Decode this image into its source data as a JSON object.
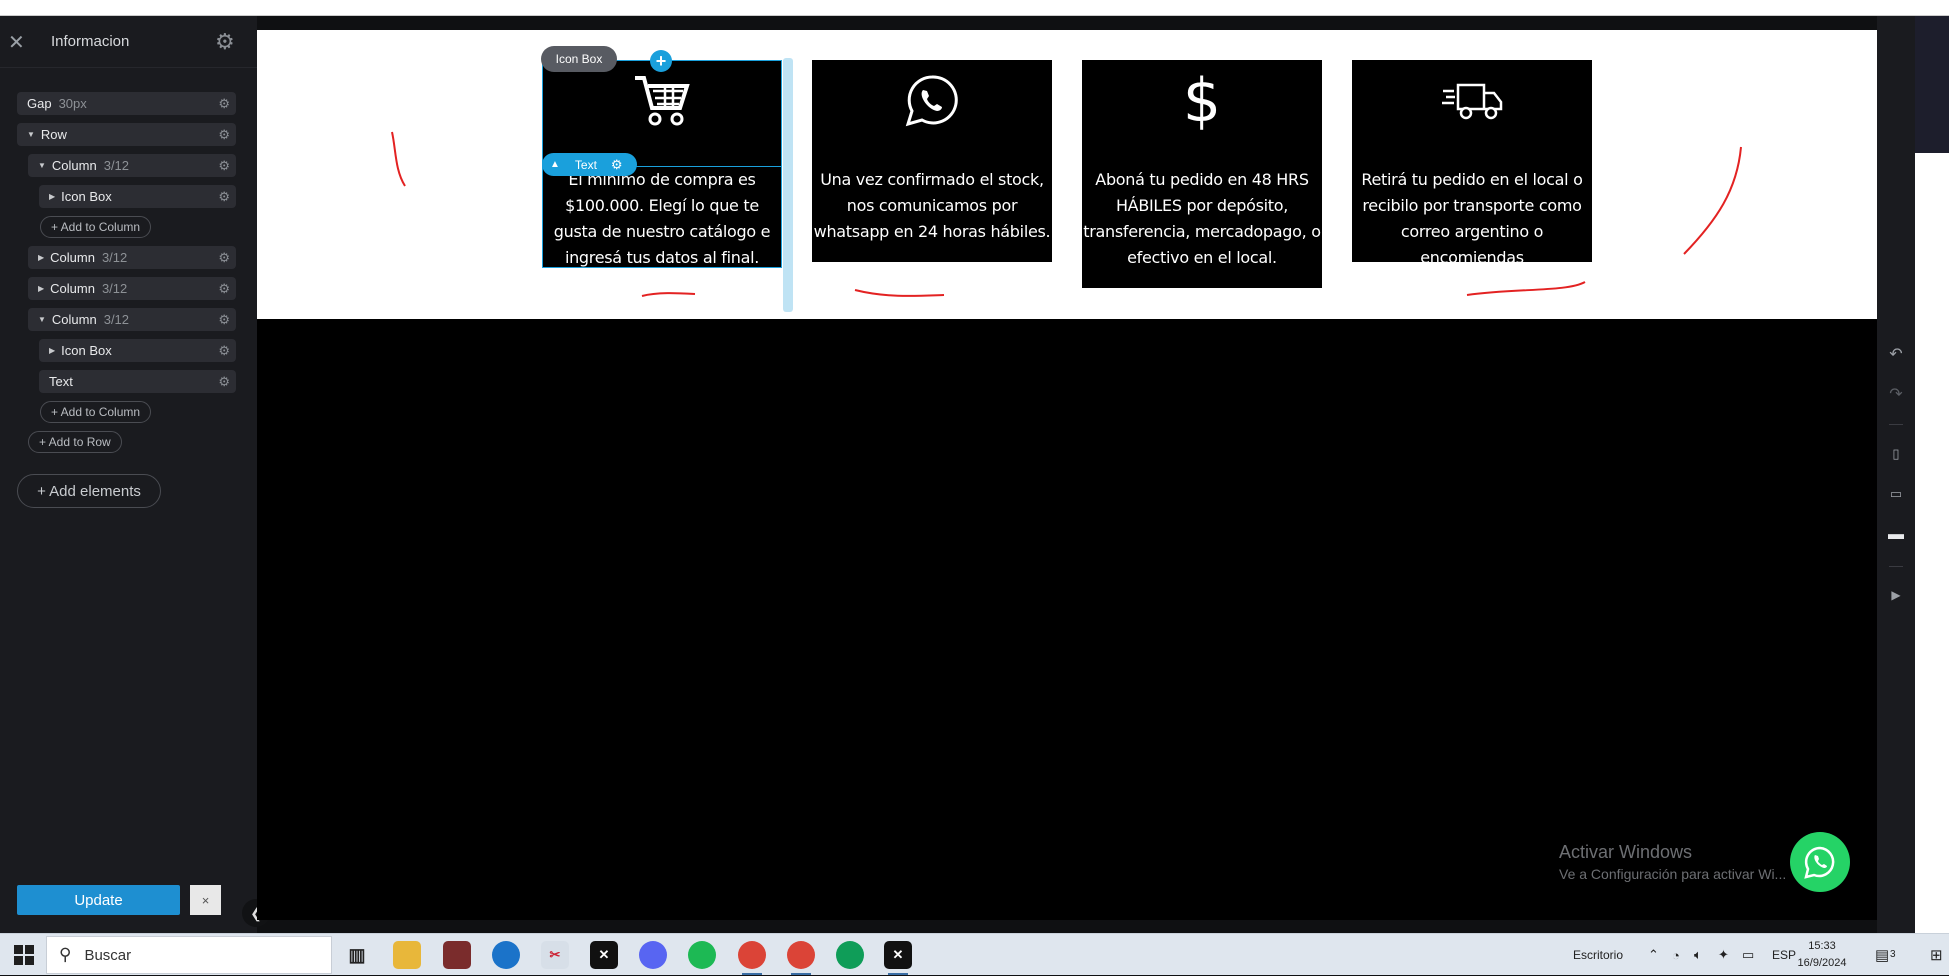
{
  "sidebar": {
    "title": "Informacion",
    "tree": {
      "gap_label": "Gap",
      "gap_value": "30px",
      "row_label": "Row",
      "column_label": "Column",
      "column_size": "3/12",
      "icon_box_label": "Icon Box",
      "text_label": "Text",
      "add_to_column": "+ Add to Column",
      "add_to_row": "+ Add to Row"
    },
    "add_elements": "+ Add elements",
    "update_label": "Update",
    "close_label": "×"
  },
  "canvas": {
    "icon_box_tag": "Icon Box",
    "text_tag": "Text",
    "cards": [
      {
        "icon": "shopping-cart-icon",
        "text": "El mínimo de compra es $100.000. Elegí lo que te gusta de nuestro catálogo e ingresá tus datos al final."
      },
      {
        "icon": "whatsapp-icon",
        "text": "Una vez confirmado el stock, nos comunicamos por whatsapp en 24 horas hábiles."
      },
      {
        "icon": "dollar-icon",
        "text": "Aboná tu pedido en 48 HRS HÁBILES por depósito, transferencia, mercadopago, o efectivo en el local."
      },
      {
        "icon": "delivery-truck-icon",
        "text": "Retirá tu pedido en el local o recibilo por transporte como correo argentino o encomiendas"
      }
    ],
    "watermark": {
      "title": "Activar Windows",
      "subtitle": "Ve a Configuración para activar Wi..."
    }
  },
  "taskbar": {
    "search_placeholder": "Buscar",
    "desktop_label": "Escritorio",
    "language": "ESP",
    "time": "15:33",
    "date": "16/9/2024",
    "notifications": "3"
  },
  "colors": {
    "accent": "#1aa0dc",
    "whatsapp": "#25d366",
    "update_button": "#1e8fd1"
  }
}
